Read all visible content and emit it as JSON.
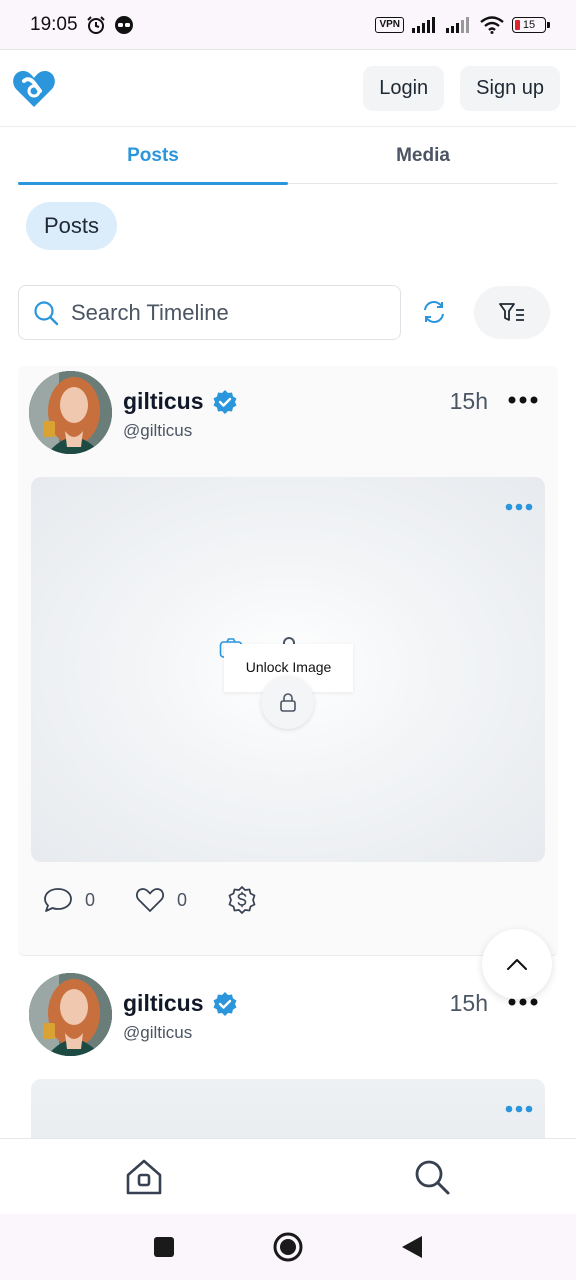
{
  "status_bar": {
    "time": "19:05",
    "vpn_label": "VPN",
    "battery_level": "15",
    "icons": [
      "alarm-icon",
      "incognito-icon",
      "signal-icon",
      "wifi-icon",
      "battery-icon"
    ]
  },
  "header": {
    "logo_icon": "heart-logo-icon",
    "login_label": "Login",
    "signup_label": "Sign up"
  },
  "tabs": [
    {
      "label": "Posts",
      "active": true
    },
    {
      "label": "Media",
      "active": false
    }
  ],
  "filter_chip": {
    "label": "Posts"
  },
  "search": {
    "placeholder": "Search Timeline",
    "value": ""
  },
  "posts": [
    {
      "display_name": "gilticus",
      "verified": true,
      "handle": "@gilticus",
      "time": "15h",
      "media": {
        "unlock_label": "Unlock Image",
        "locked": true
      },
      "comments": "0",
      "likes": "0"
    },
    {
      "display_name": "gilticus",
      "verified": true,
      "handle": "@gilticus",
      "time": "15h"
    }
  ],
  "colors": {
    "accent": "#2b96dc",
    "chip_bg": "#dbecfb",
    "verified": "#2b96dc",
    "battery_low": "#e0262d"
  }
}
